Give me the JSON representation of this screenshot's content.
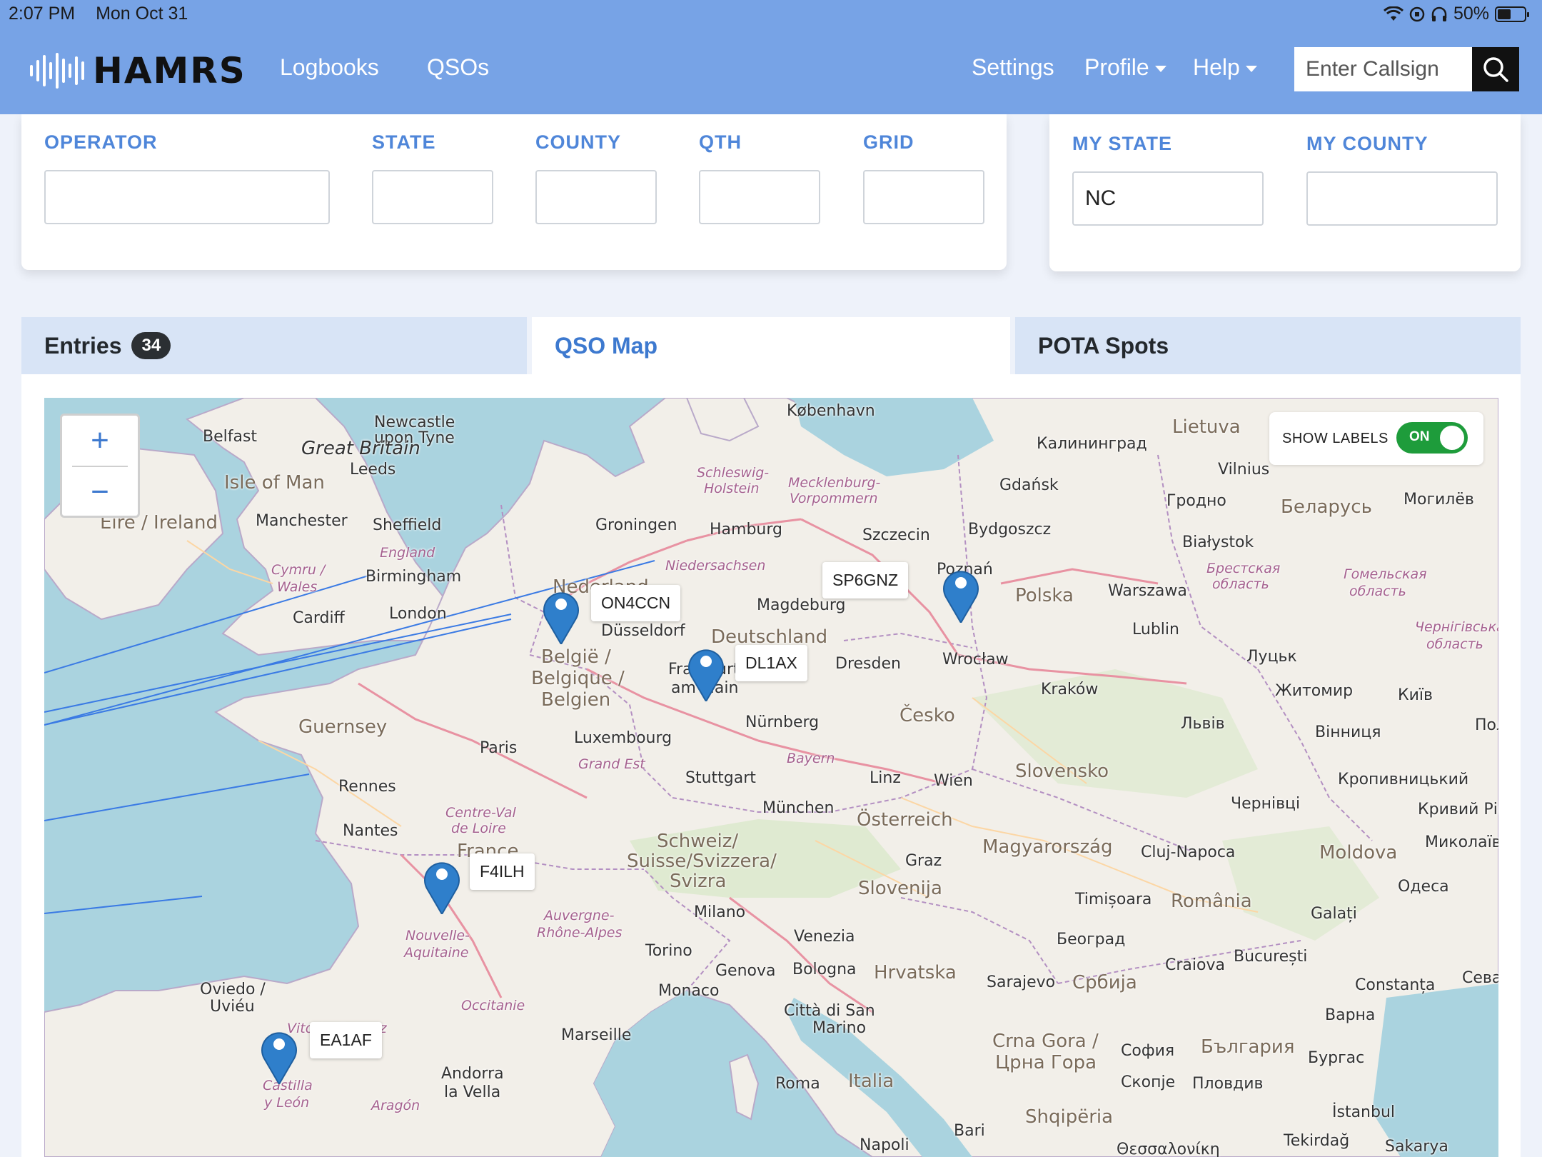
{
  "status_bar": {
    "time": "2:07 PM",
    "date": "Mon Oct 31",
    "battery": "50%",
    "battery_level": 0.5
  },
  "nav": {
    "brand": "HAMRS",
    "links": [
      "Logbooks",
      "QSOs"
    ],
    "settings": "Settings",
    "profile": "Profile",
    "help": "Help",
    "search_placeholder": "Enter Callsign"
  },
  "fields": {
    "operator": {
      "label": "OPERATOR",
      "value": ""
    },
    "state": {
      "label": "STATE",
      "value": ""
    },
    "county": {
      "label": "COUNTY",
      "value": ""
    },
    "qth": {
      "label": "QTH",
      "value": ""
    },
    "grid": {
      "label": "GRID",
      "value": ""
    },
    "my_state": {
      "label": "MY STATE",
      "value": "NC"
    },
    "my_county": {
      "label": "MY COUNTY",
      "value": ""
    }
  },
  "tabs": {
    "entries": {
      "label": "Entries",
      "count": "34"
    },
    "qso_map": {
      "label": "QSO Map"
    },
    "pota_spots": {
      "label": "POTA Spots"
    },
    "active": "qso_map"
  },
  "map": {
    "zoom_in": "+",
    "zoom_out": "−",
    "show_labels": "SHOW LABELS",
    "toggle_state": "ON",
    "callsigns": [
      "ON4CCN",
      "DL1AX",
      "SP6GNZ",
      "F4ILH",
      "EA1AF"
    ],
    "places": {
      "kobenhavn": "København",
      "newcastle": "Newcastle",
      "upon_tyne": "upon Tyne",
      "belfast": "Belfast",
      "great_britain": "Great Britain",
      "isle_of_man": "Isle of Man",
      "leeds": "Leeds",
      "eire": "Éire / Ireland",
      "manchester": "Manchester",
      "sheffield": "Sheffield",
      "england": "England",
      "cymru": "Cymru /",
      "wales": "Wales",
      "birmingham": "Birmingham",
      "cardiff": "Cardiff",
      "london": "London",
      "groningen": "Groningen",
      "hamburg": "Hamburg",
      "schleswig": "Schleswig-",
      "holstein": "Holstein",
      "mecklenburg": "Mecklenburg-",
      "vorpommern": "Vorpommern",
      "niedersachsen": "Niedersachsen",
      "szczecin": "Szczecin",
      "bydgoszcz": "Bydgoszcz",
      "gdansk": "Gdańsk",
      "kaliningrad": "Калининград",
      "lietuva": "Lietuva",
      "vilnius": "Vilnius",
      "grodno": "Гродно",
      "belarus": "Беларусь",
      "mogilev": "Могилёв",
      "bialystok": "Białystok",
      "brest": "Брестская",
      "brest2": "область",
      "gomel": "Гомельская",
      "gomel2": "область",
      "nederland": "Nederland",
      "dusseldorf": "Düsseldorf",
      "magdeburg": "Magdeburg",
      "poznan": "Poznań",
      "polska": "Polska",
      "warszawa": "Warszawa",
      "lublin": "Lublin",
      "deutschland": "Deutschland",
      "belgie": "België /",
      "belgique": "Belgique /",
      "belgien": "Belgien",
      "frankfurt": "Frankfurt",
      "am_main": "am Main",
      "dresden": "Dresden",
      "wroclaw": "Wrocław",
      "lutsk": "Луцьк",
      "chernihiv": "Чернігівська",
      "chernihiv2": "область",
      "guernsey": "Guernsey",
      "luxembourg": "Luxembourg",
      "paris": "Paris",
      "nurnberg": "Nürnberg",
      "krakow": "Kraków",
      "cesko": "Česko",
      "zhytomyr": "Житомир",
      "kyiv": "Київ",
      "lviv": "Львів",
      "grand_est": "Grand Est",
      "rennes": "Rennes",
      "stuttgart": "Stuttgart",
      "bayern": "Bayern",
      "linz": "Linz",
      "wien": "Wien",
      "slovensko": "Slovensko",
      "vinnytsia": "Вінниця",
      "kropyvnytskyi": "Кропивницький",
      "centre_val": "Centre-Val",
      "de_loire": "de Loire",
      "munchen": "München",
      "osterreich": "Österreich",
      "chernivtsi": "Чернівці",
      "kryvyi": "Кривий Ріг",
      "nantes": "Nantes",
      "schweiz": "Schweiz/",
      "suisse": "Suisse/Svizzera/",
      "svizra": "Svizra",
      "magyarorszag": "Magyarország",
      "cluj": "Cluj-Napoca",
      "moldova": "Moldova",
      "mykolaiv": "Миколаїв",
      "france": "France",
      "graz": "Graz",
      "slovenija": "Slovenija",
      "timisoara": "Timișoara",
      "romania": "România",
      "odesa": "Одеса",
      "auvergne": "Auvergne-",
      "rhone": "Rhône-Alpes",
      "milano": "Milano",
      "galati": "Galați",
      "nouvelle": "Nouvelle-",
      "aquitaine": "Aquitaine",
      "venezia": "Venezia",
      "beograd": "Београд",
      "torino": "Torino",
      "genova": "Genova",
      "bologna": "Bologna",
      "hrvatska": "Hrvatska",
      "craiova": "Craiova",
      "bucuresti": "București",
      "oviedo": "Oviedo /",
      "uvieu": "Uviéu",
      "monaco": "Monaco",
      "sarajevo": "Sarajevo",
      "srbija": "Србија",
      "constanta": "Constanța",
      "occitanie": "Occitanie",
      "san_marino": "Città di San",
      "marino": "Marino",
      "varna": "Варна",
      "marseille": "Marseille",
      "crna_gora": "Crna Gora /",
      "crna_gora2": "Црна Гора",
      "sofia": "София",
      "bulgaria": "България",
      "burgas": "Бургас",
      "andorra": "Andorra",
      "la_vella": "la Vella",
      "roma": "Roma",
      "italia": "Italia",
      "skopje": "Скопје",
      "plovdiv": "Пловдив",
      "castilla": "Castilla",
      "y_leon": "y León",
      "aragon": "Aragón",
      "shqiperia": "Shqipëria",
      "istanbul": "İstanbul",
      "bari": "Bari",
      "napoli": "Napoli",
      "tekirdag": "Tekirdağ",
      "sakarya": "Sakarya",
      "thessaloniki": "Θεσσαλονίκη",
      "vitoria": "Vitoria-Gasteiz",
      "poltava": "Пол",
      "seva": "Сева"
    }
  }
}
